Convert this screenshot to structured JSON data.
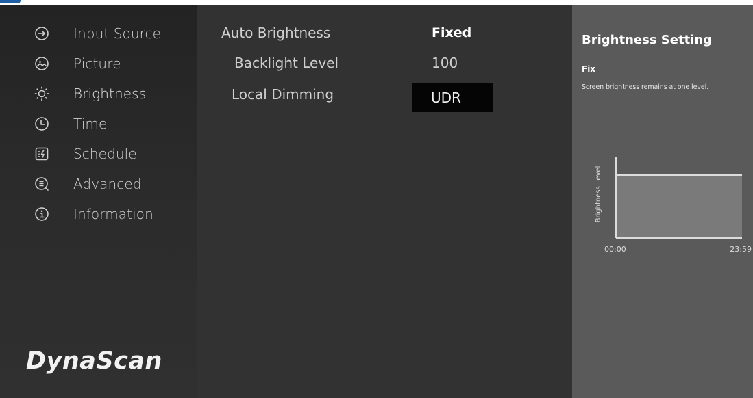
{
  "app": {
    "logo_text": "DynaScan"
  },
  "sidebar": {
    "items": [
      {
        "label": "Input Source",
        "icon": "arrow-circle-icon"
      },
      {
        "label": "Picture",
        "icon": "picture-icon"
      },
      {
        "label": "Brightness",
        "icon": "brightness-icon",
        "active": true
      },
      {
        "label": "Time",
        "icon": "clock-icon"
      },
      {
        "label": "Schedule",
        "icon": "schedule-icon"
      },
      {
        "label": "Advanced",
        "icon": "advanced-icon"
      },
      {
        "label": "Information",
        "icon": "info-icon"
      }
    ]
  },
  "settings": {
    "auto_brightness": {
      "label": "Auto Brightness",
      "value": "Fixed"
    },
    "backlight_level": {
      "label": "Backlight Level",
      "value": "100"
    },
    "local_dimming": {
      "label": "Local Dimming",
      "value": "UDR"
    }
  },
  "help": {
    "title": "Brightness Setting",
    "mode": "Fix",
    "description": "Screen brightness remains at one level."
  },
  "chart_data": {
    "type": "area",
    "ylabel": "Brightness Level",
    "xlabel": "",
    "tick_labels": [
      "00:00",
      "23:59"
    ],
    "x": [
      "00:00",
      "23:59"
    ],
    "series": [
      {
        "values": [
          100,
          100
        ]
      }
    ],
    "ylim": [
      0,
      100
    ]
  },
  "colors": {
    "sidebar_bg": "#262626",
    "main_bg": "#323232",
    "help_bg": "#5a5a5a",
    "chart_fill": "#7a7a7a",
    "line": "#dcdcdc",
    "selected_value_bg": "#050505",
    "top_accent": "#1f5fa6"
  }
}
